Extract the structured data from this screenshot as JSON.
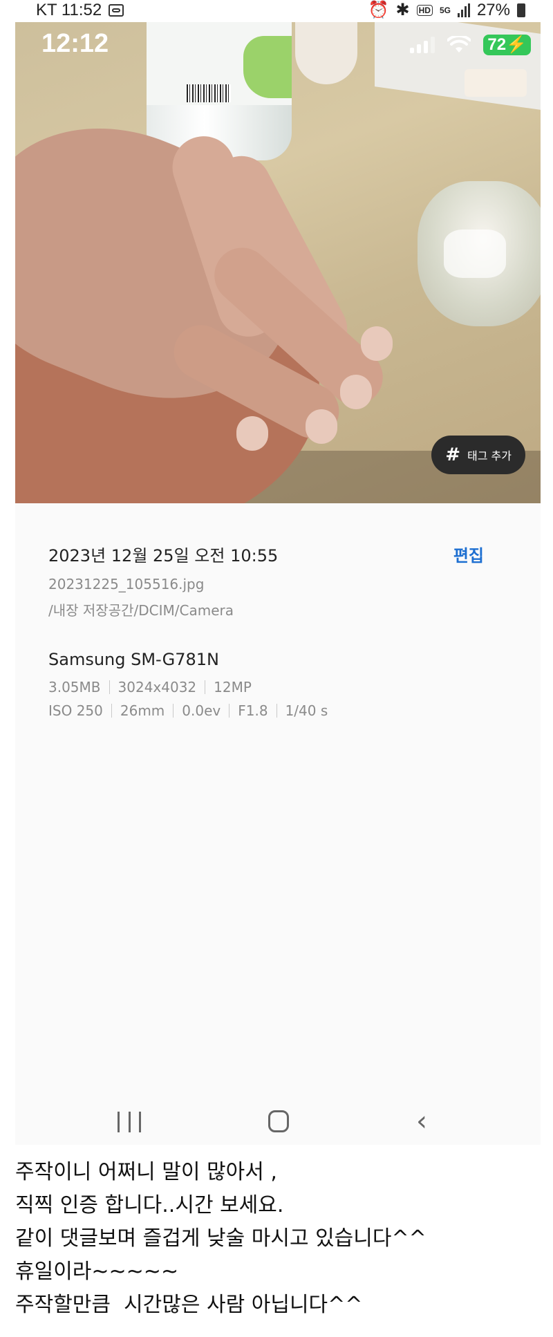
{
  "outer_status": {
    "carrier_time": "KT 11:52",
    "network": "5G",
    "battery": "27%",
    "hd": "HD"
  },
  "inner_status": {
    "time": "12:12",
    "battery": "72"
  },
  "photo": {
    "tag_button_label": "태그 추가",
    "tag_hash": "#"
  },
  "details": {
    "datetime": "2023년 12월 25일 오전 10:55",
    "edit_label": "편집",
    "filename": "20231225_105516.jpg",
    "path": "/내장 저장공간/DCIM/Camera",
    "device": "Samsung SM-G781N",
    "file_size": "3.05MB",
    "resolution": "3024x4032",
    "megapixels": "12MP",
    "iso": "ISO 250",
    "focal_length": "26mm",
    "exposure": "0.0ev",
    "aperture": "F1.8",
    "shutter": "1/40 s"
  },
  "nav": {
    "back_glyph": "‹"
  },
  "post_lines": [
    "주작이니 어쩌니 말이 많아서 ,",
    "직찍 인증 합니다..시간 보세요.",
    "같이 댓글보며 즐겁게 낮술 마시고 있습니다^^",
    "휴일이라~~~~~",
    "주작할만큼  시간많은 사람 아닙니다^^"
  ]
}
